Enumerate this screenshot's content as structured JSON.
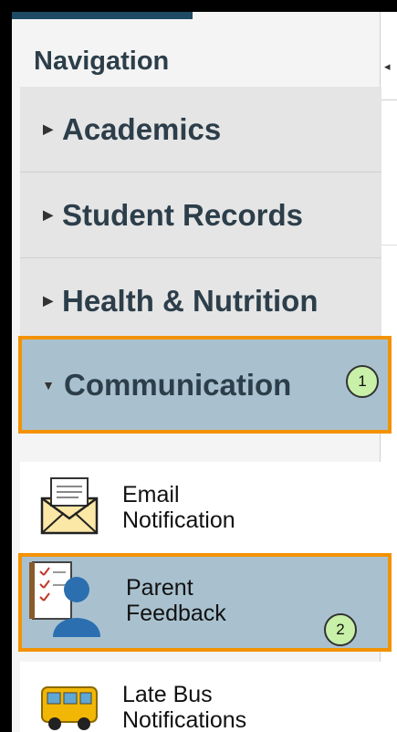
{
  "navigation": {
    "title": "Navigation",
    "sections": [
      {
        "label": "Academics",
        "expanded": false
      },
      {
        "label": "Student Records",
        "expanded": false
      },
      {
        "label": "Health & Nutrition",
        "expanded": false
      },
      {
        "label": "Communication",
        "expanded": true
      }
    ],
    "communication_items": [
      {
        "line1": "Email",
        "line2": "Notification",
        "icon": "email-envelope-icon"
      },
      {
        "line1": "Parent",
        "line2": "Feedback",
        "icon": "parent-feedback-icon"
      },
      {
        "line1": "Late Bus",
        "line2": "Notifications",
        "icon": "school-bus-icon"
      }
    ]
  },
  "callouts": {
    "step1": "1",
    "step2": "2"
  },
  "colors": {
    "highlight_border": "#f39200",
    "selected_bg": "#a9c1cf",
    "badge_bg": "#c8f0a8"
  }
}
